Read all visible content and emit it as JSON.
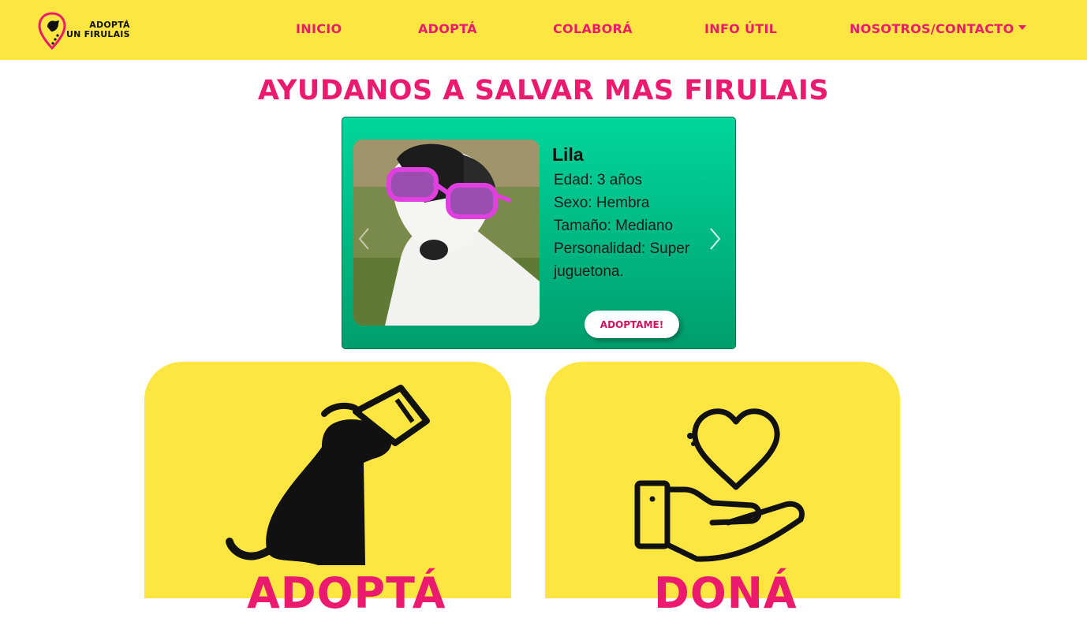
{
  "brand": {
    "logo_line1": "ADOPTÁ",
    "logo_line2": "UN FIRULAIS",
    "accent_color": "#ec1a6e",
    "nav_bg": "#fde642"
  },
  "nav": {
    "items": [
      {
        "label": "INICIO"
      },
      {
        "label": "ADOPTÁ"
      },
      {
        "label": "COLABORÁ"
      },
      {
        "label": "INFO ÚTIL"
      },
      {
        "label": "NOSOTROS/CONTACTO",
        "dropdown": true
      }
    ]
  },
  "headline": "AYUDANOS A SALVAR MAS FIRULAIS",
  "carousel": {
    "pet": {
      "name": "Lila",
      "age": "Edad: 3 años",
      "sex": "Sexo: Hembra",
      "size": "Tamaño: Mediano",
      "personality": "Personalidad: Super juguetona."
    },
    "adopt_label": "ADOPTAME!",
    "prev_icon": "chevron-left-icon",
    "next_icon": "chevron-right-icon"
  },
  "cards": [
    {
      "icon": "dog-cone-icon",
      "title": "ADOPTÁ"
    },
    {
      "icon": "hand-heart-icon",
      "title": "DONÁ"
    }
  ]
}
